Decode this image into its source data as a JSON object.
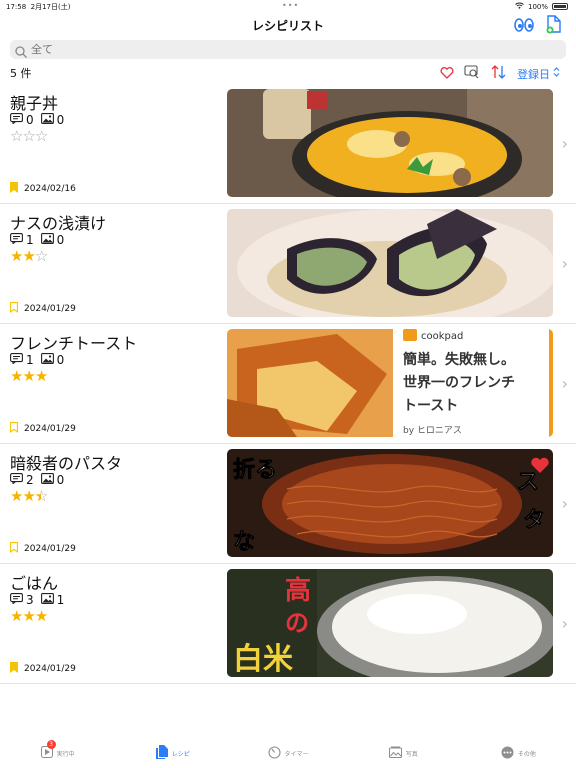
{
  "status": {
    "time": "17:58",
    "date": "2月17日(土)",
    "battery": "100%"
  },
  "nav": {
    "title": "レシピリスト"
  },
  "search": {
    "placeholder": "全て"
  },
  "toolbar": {
    "count": "5 件",
    "sort_label": "登録日"
  },
  "recipes": [
    {
      "name": "親子丼",
      "comments": "0",
      "photos": "0",
      "rating": 0,
      "date": "2024/02/16",
      "bookmarked": true
    },
    {
      "name": "ナスの浅漬け",
      "comments": "1",
      "photos": "0",
      "rating": 2,
      "date": "2024/01/29",
      "bookmarked": false
    },
    {
      "name": "フレンチトースト",
      "comments": "1",
      "photos": "0",
      "rating": 3,
      "date": "2024/01/29",
      "bookmarked": false
    },
    {
      "name": "暗殺者のパスタ",
      "comments": "2",
      "photos": "0",
      "rating": 2.5,
      "date": "2024/01/29",
      "bookmarked": false
    },
    {
      "name": "ごはん",
      "comments": "3",
      "photos": "1",
      "rating": 3,
      "date": "2024/01/29",
      "bookmarked": true
    }
  ],
  "thumbs": {
    "toast_brand": "cookpad",
    "toast_caption": "簡単。失敗無し。世界一のフレンチトースト",
    "toast_byline": "by ヒロニアス",
    "pasta_text_left": "折るな",
    "pasta_text_right": "スタは",
    "rice_text": "高の白米"
  },
  "tabs": [
    {
      "label": "実行中",
      "badge": "3"
    },
    {
      "label": "レシピ"
    },
    {
      "label": "タイマー"
    },
    {
      "label": "写真"
    },
    {
      "label": "その他"
    }
  ],
  "colors": {
    "accent": "#2b7cf6",
    "star": "#f6b400",
    "bookmark": "#f5c400",
    "heart": "#e8323c"
  }
}
